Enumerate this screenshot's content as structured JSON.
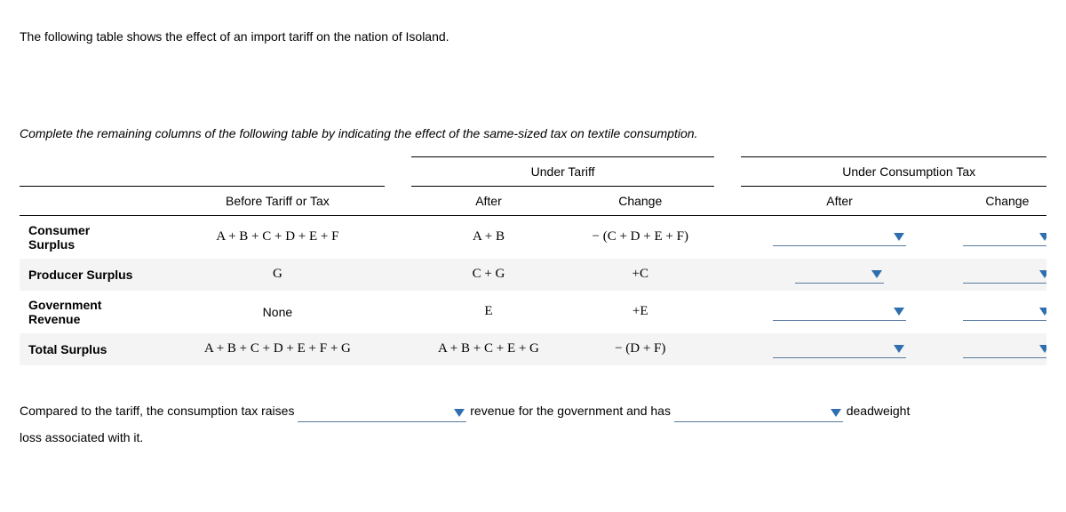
{
  "intro": "The following table shows the effect of an import tariff on the nation of Isoland.",
  "prompt": "Complete the remaining columns of the following table by indicating the effect of the same-sized tax on textile consumption.",
  "headers": {
    "before": "Before Tariff or Tax",
    "under_tariff": "Under Tariff",
    "under_tax": "Under Consumption Tax",
    "after": "After",
    "change": "Change"
  },
  "rows": {
    "consumer_surplus": {
      "label1": "Consumer",
      "label2": "Surplus",
      "before": "A + B + C + D + E + F",
      "tariff_after": "A + B",
      "tariff_change": "− (C + D + E + F)"
    },
    "producer_surplus": {
      "label": "Producer Surplus",
      "before": "G",
      "tariff_after": "C + G",
      "tariff_change": "+C"
    },
    "gov_revenue": {
      "label1": "Government",
      "label2": "Revenue",
      "before": "None",
      "tariff_after": "E",
      "tariff_change": "+E"
    },
    "total_surplus": {
      "label": "Total Surplus",
      "before": "A + B + C + D + E + F + G",
      "tariff_after": "A + B + C + E + G",
      "tariff_change": "− (D + F)"
    }
  },
  "closing": {
    "part1": "Compared to the tariff, the consumption tax raises",
    "part2": "revenue for the government and has",
    "part3": "deadweight",
    "part4": "loss associated with it."
  }
}
